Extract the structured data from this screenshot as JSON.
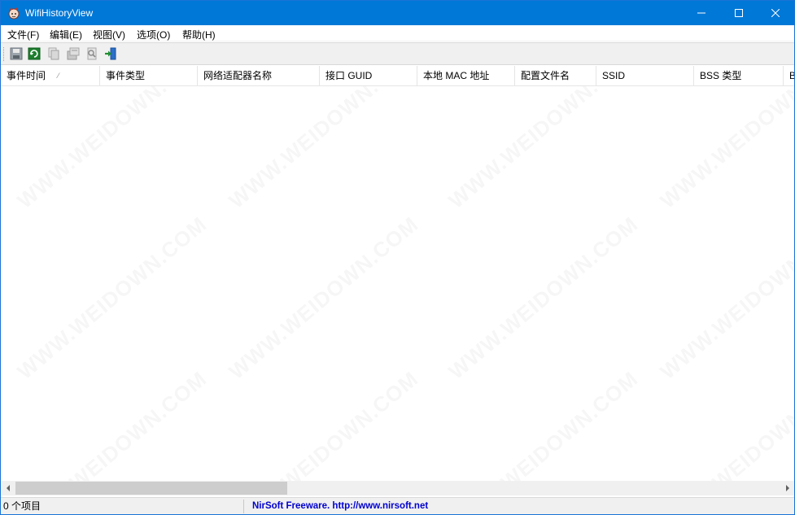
{
  "window": {
    "title": "WifiHistoryView",
    "accent_color": "#0078d7"
  },
  "menu": {
    "items": [
      {
        "label": "文件(F)"
      },
      {
        "label": "编辑(E)"
      },
      {
        "label": "视图(V)"
      },
      {
        "label": "选项(O)"
      },
      {
        "label": "帮助(H)"
      }
    ]
  },
  "toolbar": {
    "buttons": [
      {
        "icon": "save-icon"
      },
      {
        "icon": "refresh-icon"
      },
      {
        "icon": "copy-icon"
      },
      {
        "icon": "properties-icon"
      },
      {
        "icon": "html-report-icon"
      },
      {
        "icon": "exit-icon"
      }
    ]
  },
  "list": {
    "columns": [
      {
        "label": "事件时间",
        "sorted": true
      },
      {
        "label": "事件类型"
      },
      {
        "label": "网络适配器名称"
      },
      {
        "label": "接口 GUID"
      },
      {
        "label": "本地 MAC 地址"
      },
      {
        "label": "配置文件名"
      },
      {
        "label": "SSID"
      },
      {
        "label": "BSS 类型"
      },
      {
        "label": "B"
      }
    ],
    "rows": []
  },
  "watermark": {
    "text": "WWW.WEIDOWN.COM"
  },
  "statusbar": {
    "item_count": "0 个项目",
    "credit": "NirSoft Freeware.  http://www.nirsoft.net",
    "credit_color": "#0000d0"
  }
}
